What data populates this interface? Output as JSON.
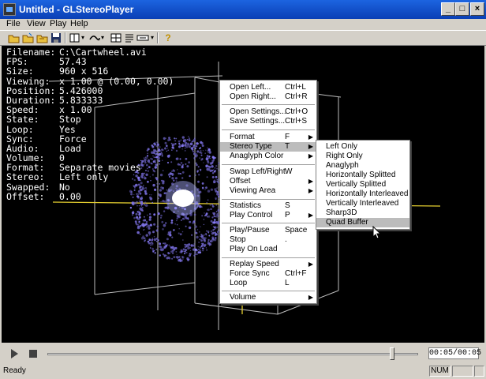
{
  "window": {
    "title": "Untitled - GLStereoPlayer"
  },
  "title_buttons": {
    "minimize": "_",
    "maximize": "□",
    "close": "×"
  },
  "menubar": [
    "File",
    "View",
    "Play",
    "Help"
  ],
  "toolbar": {
    "icons": [
      "open-icon",
      "open-folder-icon",
      "open-multi-icon",
      "save-icon",
      "layout-icon",
      "stereo-icon",
      "split-icon",
      "properties-icon",
      "view-icon",
      "help-icon"
    ]
  },
  "osd": [
    {
      "k": "Filename:",
      "v": "C:\\Cartwheel.avi"
    },
    {
      "k": "FPS:",
      "v": "57.43"
    },
    {
      "k": "Size:",
      "v": "960 x 516"
    },
    {
      "k": "Viewing:",
      "v": "x 1.00 @ (0.00, 0.00)"
    },
    {
      "k": "Position:",
      "v": "5.426000"
    },
    {
      "k": "Duration:",
      "v": "5.833333"
    },
    {
      "k": "Speed:",
      "v": "x 1.00"
    },
    {
      "k": "State:",
      "v": "Stop"
    },
    {
      "k": "Loop:",
      "v": "Yes"
    },
    {
      "k": "Sync:",
      "v": "Force"
    },
    {
      "k": "Audio:",
      "v": "Load"
    },
    {
      "k": "Volume:",
      "v": "0"
    },
    {
      "k": "Format:",
      "v": "Separate movies"
    },
    {
      "k": "Stereo:",
      "v": "Left only"
    },
    {
      "k": "Swapped:",
      "v": "No"
    },
    {
      "k": "Offset:",
      "v": "0.00"
    }
  ],
  "context_menu": {
    "items": [
      {
        "label": "Open Left...",
        "shortcut": "Ctrl+L"
      },
      {
        "label": "Open Right...",
        "shortcut": "Ctrl+R"
      },
      {
        "label": "Open Settings...",
        "shortcut": "Ctrl+O"
      },
      {
        "label": "Save Settings...",
        "shortcut": "Ctrl+S"
      },
      {
        "label": "Format",
        "shortcut": "F",
        "submenu": true
      },
      {
        "label": "Stereo Type",
        "shortcut": "T",
        "submenu": true,
        "selected": true
      },
      {
        "label": "Anaglyph Color",
        "shortcut": "",
        "submenu": true
      },
      {
        "label": "Swap Left/Right",
        "shortcut": "W"
      },
      {
        "label": "Offset",
        "shortcut": "",
        "submenu": true
      },
      {
        "label": "Viewing Area",
        "shortcut": "",
        "submenu": true
      },
      {
        "label": "Statistics",
        "shortcut": "S"
      },
      {
        "label": "Play Control",
        "shortcut": "P",
        "submenu": true
      },
      {
        "label": "Play/Pause",
        "shortcut": "Space"
      },
      {
        "label": "Stop",
        "shortcut": "."
      },
      {
        "label": "Play On Load",
        "shortcut": ""
      },
      {
        "label": "Replay Speed",
        "shortcut": "",
        "submenu": true
      },
      {
        "label": "Force Sync",
        "shortcut": "Ctrl+F"
      },
      {
        "label": "Loop",
        "shortcut": "L"
      },
      {
        "label": "Volume",
        "shortcut": "",
        "submenu": true
      }
    ]
  },
  "submenu": {
    "items": [
      {
        "label": "Left Only"
      },
      {
        "label": "Right Only"
      },
      {
        "label": "Anaglyph"
      },
      {
        "label": "Horizontally Splitted"
      },
      {
        "label": "Vertically Splitted"
      },
      {
        "label": "Horizontally Interleaved"
      },
      {
        "label": "Vertically Interleaved"
      },
      {
        "label": "Sharp3D"
      },
      {
        "label": "Quad Buffer",
        "selected": true
      }
    ]
  },
  "playback": {
    "time": "00:05/00:05",
    "progress": 0.93
  },
  "statusbar": {
    "text": "Ready",
    "num": "NUM"
  },
  "colors": {
    "title_bar": "#0a3fb5",
    "menu_highlight": "#bcbcbc",
    "grid": "#c8c8c8",
    "axis_line": "#e6d030",
    "particles": "#7a70ff"
  }
}
